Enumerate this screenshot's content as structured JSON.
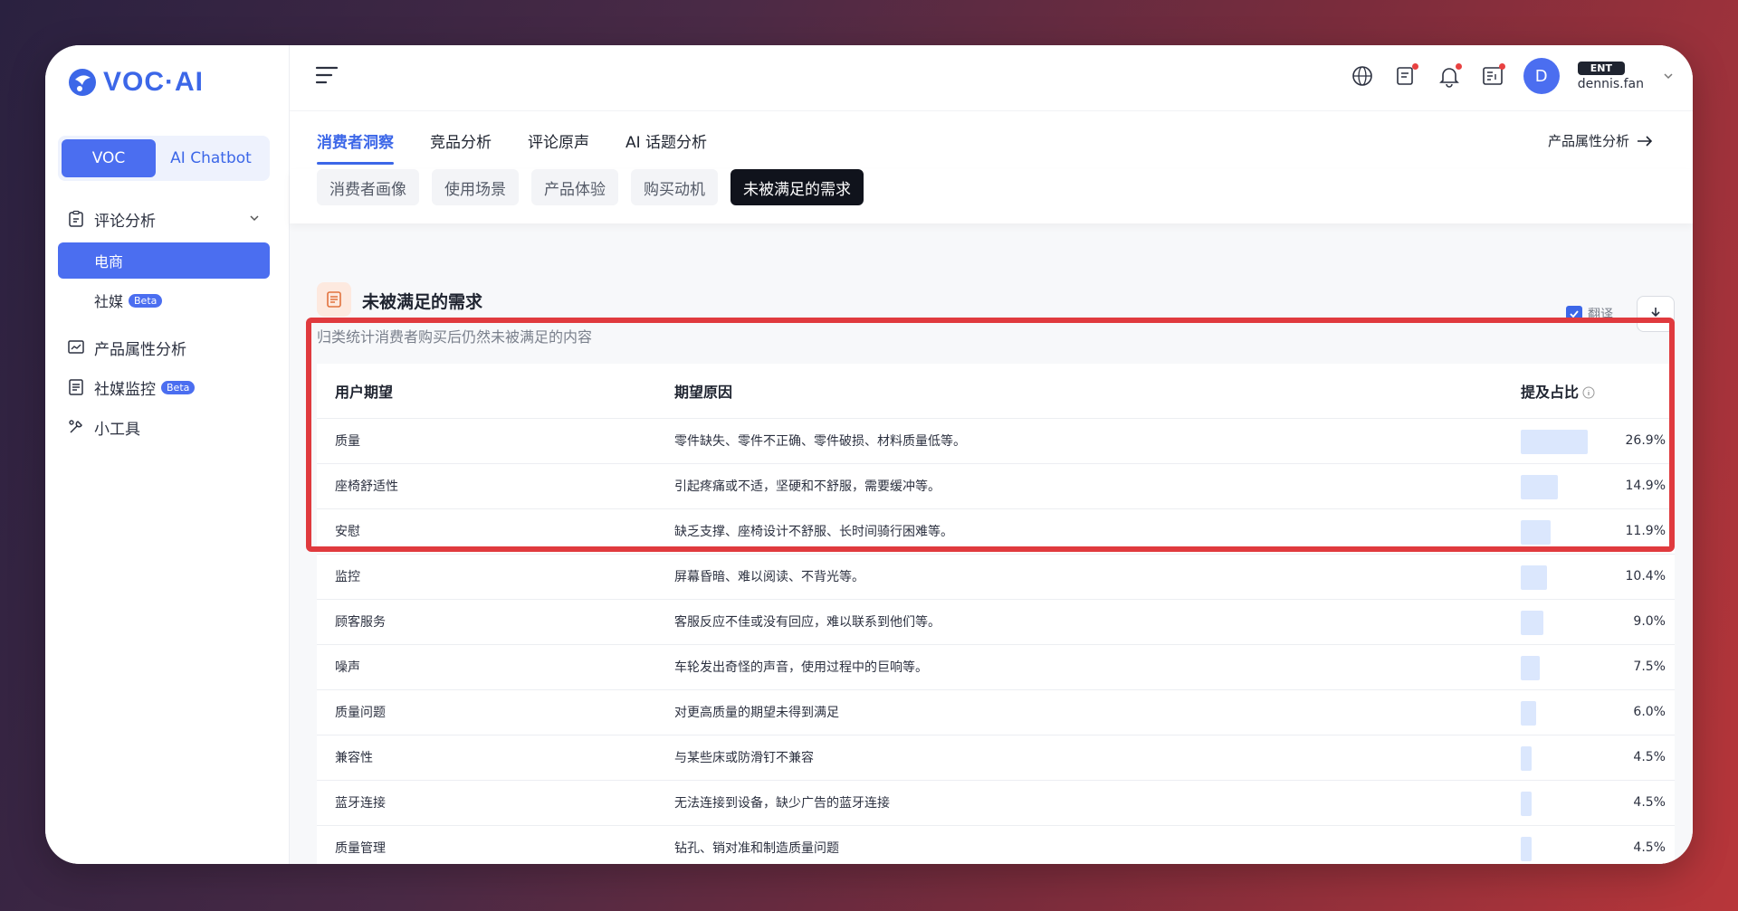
{
  "brand": {
    "logo_text": "VOC·AI",
    "accent": "#4b6ef0",
    "highlight": "#e03a3e"
  },
  "mode_switch": {
    "active": "VOC",
    "inactive": "AI Chatbot"
  },
  "sidebar": {
    "review_analysis": "评论分析",
    "ecommerce": "电商",
    "social": "社媒",
    "beta": "Beta",
    "product_attr": "产品属性分析",
    "social_monitor": "社媒监控",
    "tools": "小工具"
  },
  "user": {
    "initial": "D",
    "plan": "ENT",
    "name": "dennis.fan"
  },
  "tabs": [
    "消费者洞察",
    "竞品分析",
    "评论原声",
    "AI 话题分析"
  ],
  "attr_link": "产品属性分析",
  "subtabs": [
    "消费者画像",
    "使用场景",
    "产品体验",
    "购买动机",
    "未被满足的需求"
  ],
  "card": {
    "title": "未被满足的需求",
    "desc": "归类统计消费者购买后仍然未被满足的内容",
    "translate": "翻译"
  },
  "table": {
    "headers": [
      "用户期望",
      "期望原因",
      "提及占比"
    ],
    "rows": [
      {
        "expectation": "质量",
        "reason": "零件缺失、零件不正确、零件破损、材料质量低等。",
        "share": "26.9%",
        "value": 26.9
      },
      {
        "expectation": "座椅舒适性",
        "reason": "引起疼痛或不适，坚硬和不舒服，需要缓冲等。",
        "share": "14.9%",
        "value": 14.9
      },
      {
        "expectation": "安慰",
        "reason": "缺乏支撑、座椅设计不舒服、长时间骑行困难等。",
        "share": "11.9%",
        "value": 11.9
      },
      {
        "expectation": "监控",
        "reason": "屏幕昏暗、难以阅读、不背光等。",
        "share": "10.4%",
        "value": 10.4
      },
      {
        "expectation": "顾客服务",
        "reason": "客服反应不佳或没有回应，难以联系到他们等。",
        "share": "9.0%",
        "value": 9.0
      },
      {
        "expectation": "噪声",
        "reason": "车轮发出奇怪的声音，使用过程中的巨响等。",
        "share": "7.5%",
        "value": 7.5
      },
      {
        "expectation": "质量问题",
        "reason": "对更高质量的期望未得到满足",
        "share": "6.0%",
        "value": 6.0
      },
      {
        "expectation": "兼容性",
        "reason": "与某些床或防滑钉不兼容",
        "share": "4.5%",
        "value": 4.5
      },
      {
        "expectation": "蓝牙连接",
        "reason": "无法连接到设备，缺少广告的蓝牙连接",
        "share": "4.5%",
        "value": 4.5
      },
      {
        "expectation": "质量管理",
        "reason": "钻孔、销对准和制造质量问题",
        "share": "4.5%",
        "value": 4.5
      }
    ]
  }
}
